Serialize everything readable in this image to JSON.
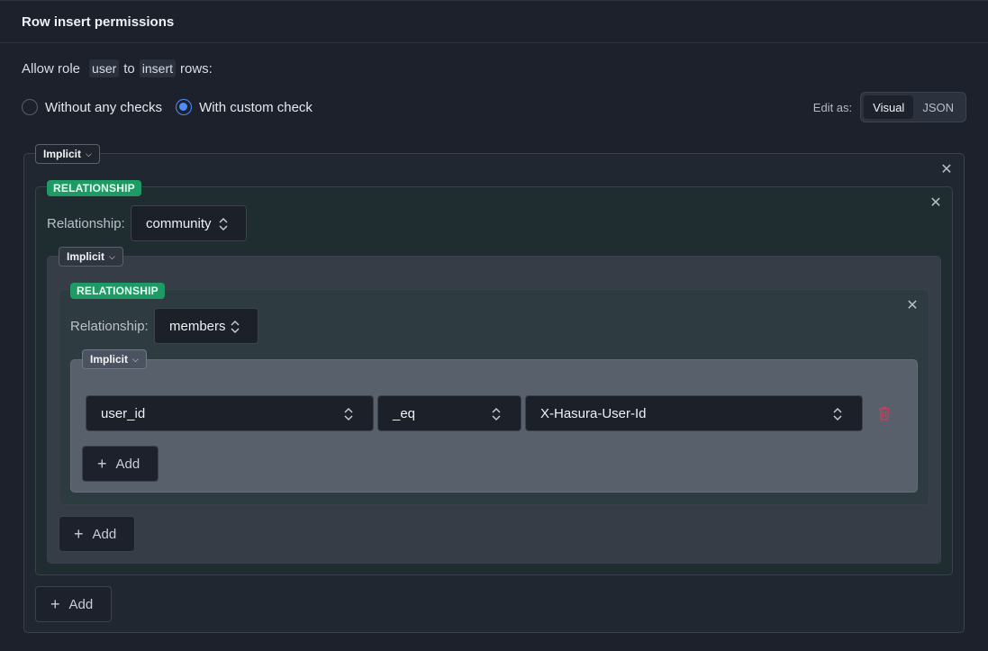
{
  "header": {
    "title": "Row insert permissions"
  },
  "allow": {
    "prefix": "Allow role",
    "role": "user",
    "mid": "to",
    "action": "insert",
    "suffix": "rows:"
  },
  "check_mode": {
    "options": [
      {
        "label": "Without any checks",
        "checked": false
      },
      {
        "label": "With custom check",
        "checked": true
      }
    ]
  },
  "edit_as": {
    "label": "Edit as:",
    "options": [
      "Visual",
      "JSON"
    ],
    "active": "Visual"
  },
  "builder": {
    "outer_group": {
      "operator": "Implicit"
    },
    "relationship_1": {
      "badge": "RELATIONSHIP",
      "label": "Relationship:",
      "value": "community"
    },
    "inner_group": {
      "operator": "Implicit"
    },
    "relationship_2": {
      "badge": "RELATIONSHIP",
      "label": "Relationship:",
      "value": "members"
    },
    "leaf_group": {
      "operator": "Implicit"
    },
    "condition": {
      "column": "user_id",
      "operator": "_eq",
      "value": "X-Hasura-User-Id"
    },
    "add_label": "Add"
  },
  "colors": {
    "accent": "#4d8dff",
    "relationship_badge": "#1e9a64",
    "delete": "#c2415a"
  }
}
